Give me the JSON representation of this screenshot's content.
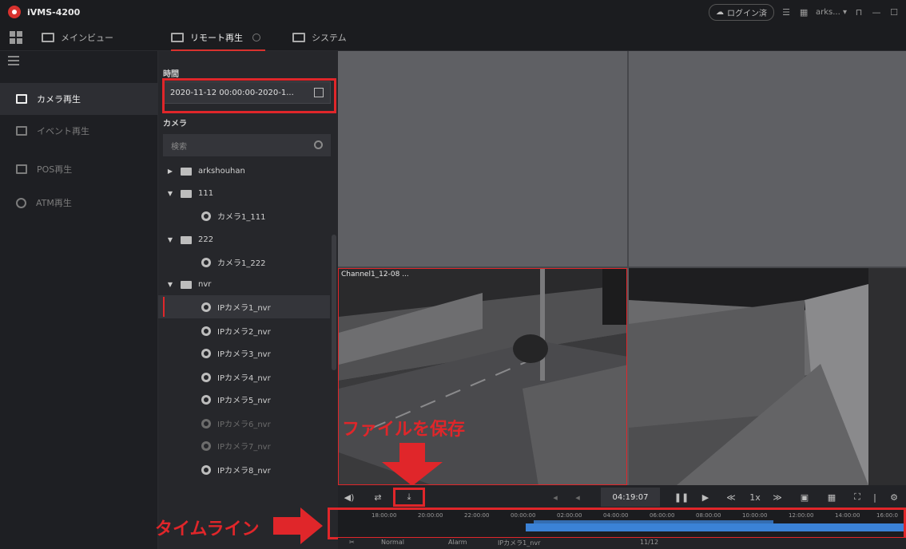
{
  "app": {
    "title": "iVMS-4200"
  },
  "titlebar": {
    "login_label": "ログイン済",
    "user_label": "arks...",
    "minimize": "—",
    "maximize": "☐",
    "lock": "🔒"
  },
  "tabs": [
    {
      "label": "メインビュー"
    },
    {
      "label": "リモート再生"
    },
    {
      "label": "システム"
    }
  ],
  "leftnav": {
    "items": [
      {
        "label": "カメラ再生",
        "active": true
      },
      {
        "label": "イベント再生",
        "active": false
      },
      {
        "label": "POS再生",
        "active": false
      },
      {
        "label": "ATM再生",
        "active": false
      }
    ]
  },
  "panel": {
    "time_section_label": "時間",
    "date_range": "2020-11-12 00:00:00-2020-1...",
    "camera_section_label": "カメラ",
    "search_placeholder": "検索",
    "tree": [
      {
        "type": "group",
        "label": "arkshouhan",
        "expanded": false
      },
      {
        "type": "group",
        "label": "111",
        "expanded": true
      },
      {
        "type": "camera",
        "label": "カメラ1_111"
      },
      {
        "type": "group",
        "label": "222",
        "expanded": true
      },
      {
        "type": "camera",
        "label": "カメラ1_222"
      },
      {
        "type": "group",
        "label": "nvr",
        "expanded": true
      },
      {
        "type": "camera",
        "label": "IPカメラ1_nvr",
        "selected": true
      },
      {
        "type": "camera",
        "label": "IPカメラ2_nvr"
      },
      {
        "type": "camera",
        "label": "IPカメラ3_nvr"
      },
      {
        "type": "camera",
        "label": "IPカメラ4_nvr"
      },
      {
        "type": "camera",
        "label": "IPカメラ5_nvr"
      },
      {
        "type": "camera",
        "label": "IPカメラ6_nvr",
        "dim": true
      },
      {
        "type": "camera",
        "label": "IPカメラ7_nvr",
        "dim": true
      },
      {
        "type": "camera",
        "label": "IPカメラ8_nvr"
      }
    ]
  },
  "video": {
    "cam1_label": "Channel1_12-08 ..."
  },
  "playback": {
    "time": "04:19:07",
    "speed": "1x"
  },
  "timeline": {
    "ticks": [
      "18:00:00",
      "20:00:00",
      "22:00:00",
      "00:00:00",
      "02:00:00",
      "04:00:00",
      "06:00:00",
      "08:00:00",
      "10:00:00",
      "12:00:00",
      "14:00:00",
      "16:00:0"
    ],
    "bottom_labels": [
      "Normal",
      "Alarm",
      "IPカメラ1_nvr"
    ],
    "bottom_date": "11/12"
  },
  "annotations": {
    "save_file": "ファイルを保存",
    "timeline": "タイムライン"
  },
  "colors": {
    "accent": "#e0262a",
    "timeline_blue": "#3b82d6"
  }
}
